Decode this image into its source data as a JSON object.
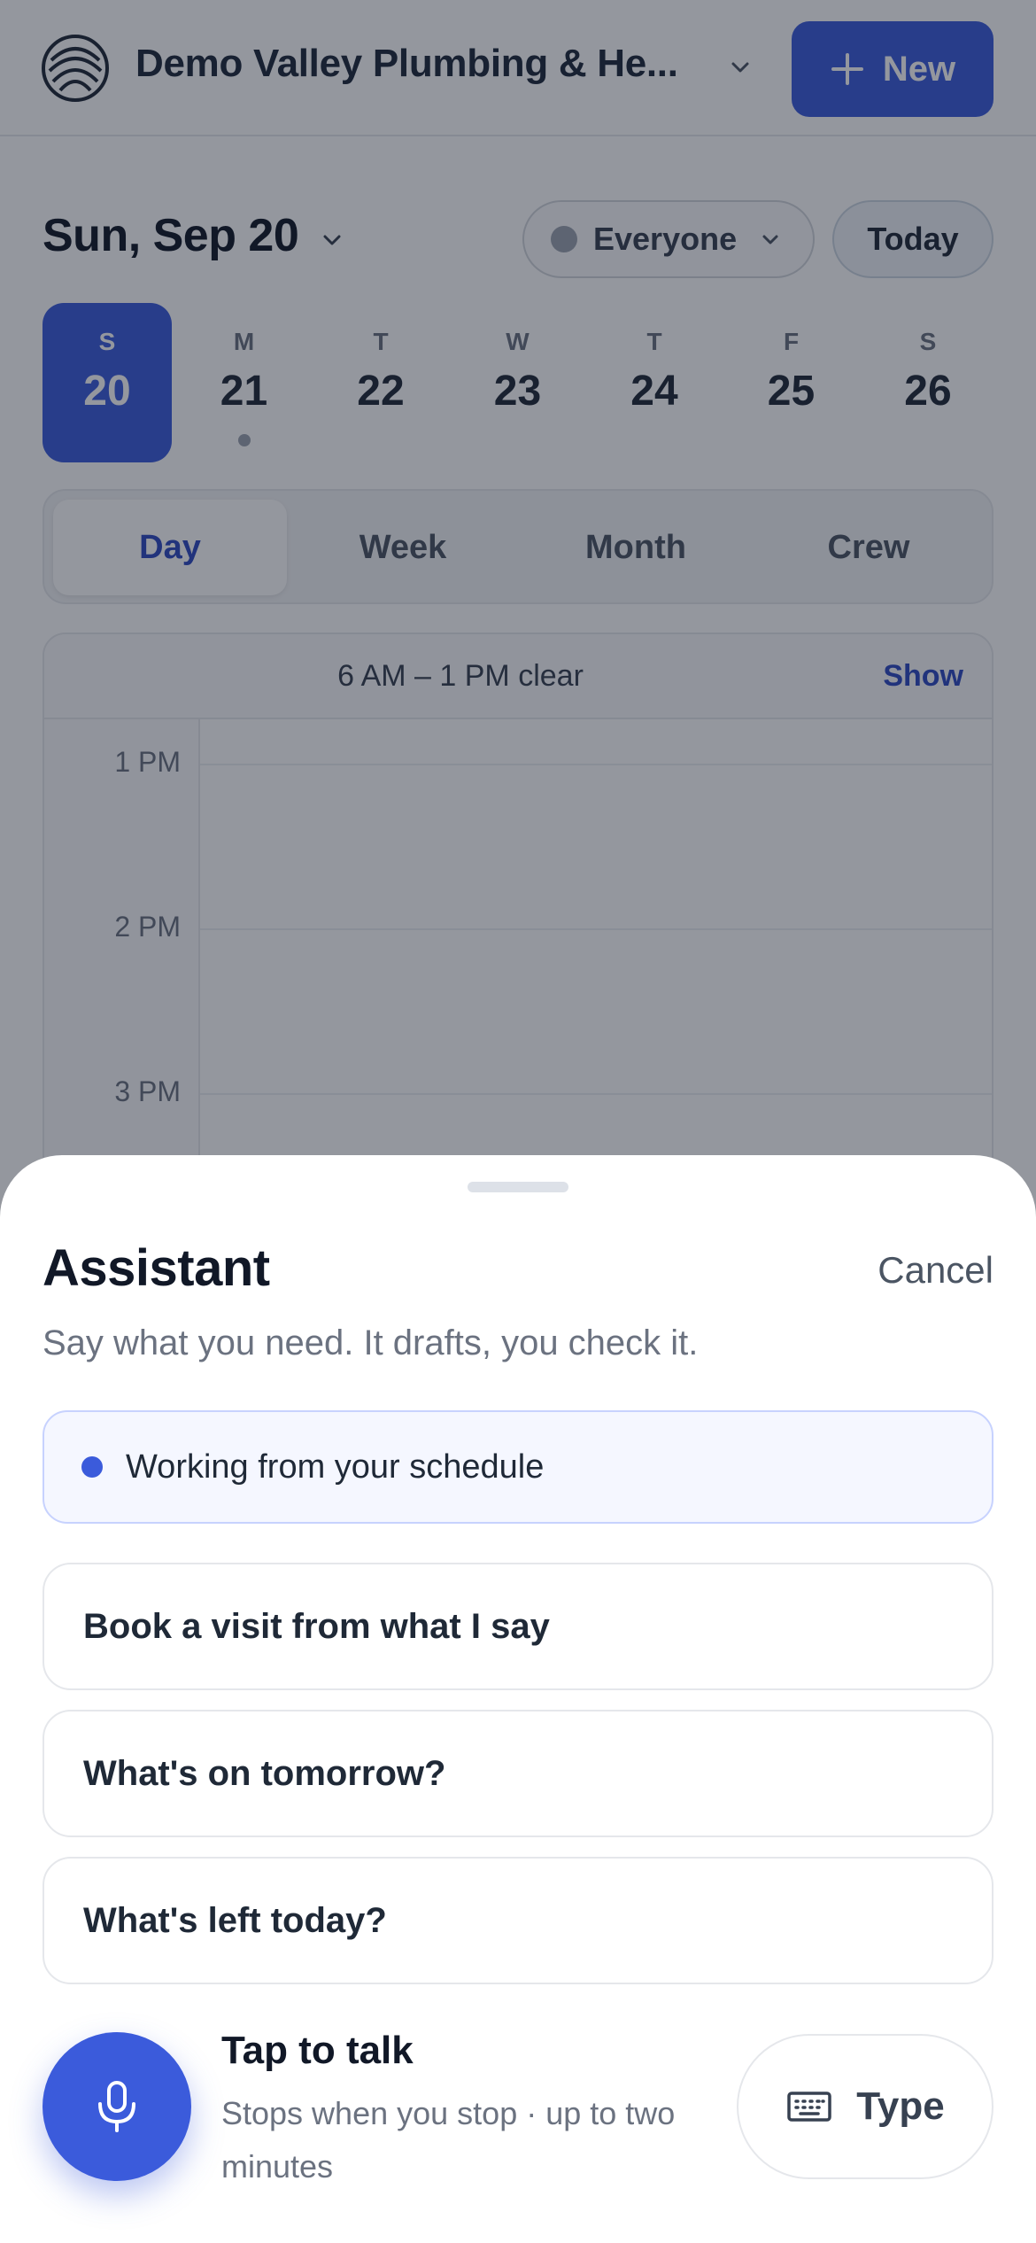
{
  "header": {
    "company_name": "Demo Valley Plumbing & He...",
    "new_button": "New"
  },
  "schedule": {
    "date_title": "Sun, Sep 20",
    "filter_label": "Everyone",
    "today_button": "Today",
    "week_days": [
      {
        "letter": "S",
        "number": "20",
        "selected": true,
        "has_events": false
      },
      {
        "letter": "M",
        "number": "21",
        "selected": false,
        "has_events": true
      },
      {
        "letter": "T",
        "number": "22",
        "selected": false,
        "has_events": false
      },
      {
        "letter": "W",
        "number": "23",
        "selected": false,
        "has_events": false
      },
      {
        "letter": "T",
        "number": "24",
        "selected": false,
        "has_events": false
      },
      {
        "letter": "F",
        "number": "25",
        "selected": false,
        "has_events": false
      },
      {
        "letter": "S",
        "number": "26",
        "selected": false,
        "has_events": false
      }
    ],
    "views": [
      "Day",
      "Week",
      "Month",
      "Crew"
    ],
    "active_view": "Day",
    "clear_range": "6 AM – 1 PM clear",
    "show_link": "Show",
    "hours": [
      "1 PM",
      "2 PM",
      "3 PM"
    ]
  },
  "assistant": {
    "title": "Assistant",
    "cancel": "Cancel",
    "subtitle": "Say what you need. It drafts, you check it.",
    "status": "Working from your schedule",
    "suggestions": [
      "Book a visit from what I say",
      "What's on tomorrow?",
      "What's left today?"
    ],
    "talk_title": "Tap to talk",
    "talk_subtitle": "Stops when you stop · up to two minutes",
    "type_button": "Type"
  },
  "colors": {
    "accent": "#3b5bdb",
    "scrim": "rgba(17,24,39,0.45)"
  },
  "icons": [
    "logo-icon",
    "chevron-down-icon",
    "plus-icon",
    "microphone-icon",
    "keyboard-icon"
  ]
}
